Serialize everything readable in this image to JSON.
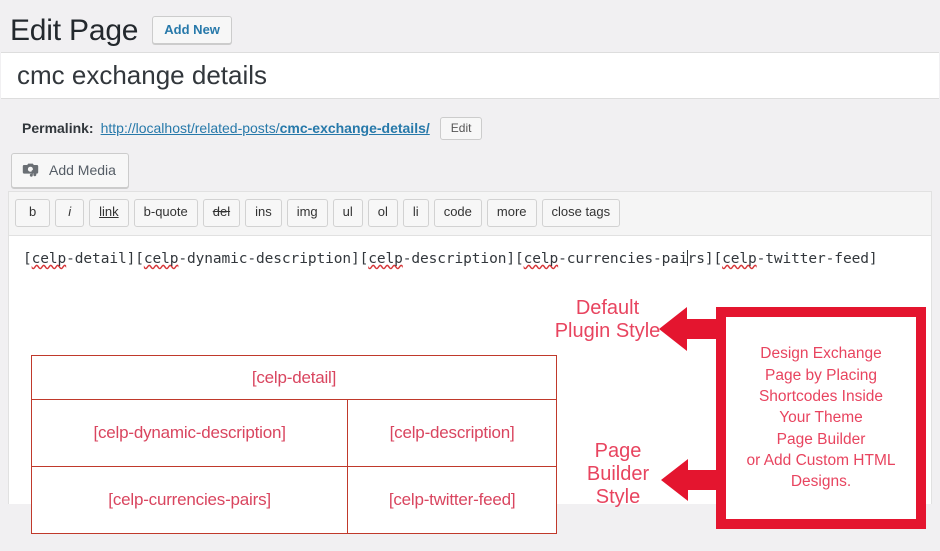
{
  "header": {
    "title": "Edit Page",
    "add_new_label": "Add New"
  },
  "title_field": {
    "value": "cmc exchange details"
  },
  "permalink": {
    "label": "Permalink:",
    "base": "http://localhost/related-posts/",
    "slug": "cmc-exchange-details/",
    "edit_label": "Edit"
  },
  "media": {
    "add_media_label": "Add Media",
    "icon": "camera-music-icon"
  },
  "quicktags": [
    {
      "label": "b",
      "style": "style-bold"
    },
    {
      "label": "i",
      "style": "style-italic"
    },
    {
      "label": "link",
      "style": "style-underline"
    },
    {
      "label": "b-quote",
      "style": ""
    },
    {
      "label": "del",
      "style": "style-strike"
    },
    {
      "label": "ins",
      "style": ""
    },
    {
      "label": "img",
      "style": ""
    },
    {
      "label": "ul",
      "style": ""
    },
    {
      "label": "ol",
      "style": ""
    },
    {
      "label": "li",
      "style": ""
    },
    {
      "label": "code",
      "style": ""
    },
    {
      "label": "more",
      "style": ""
    },
    {
      "label": "close tags",
      "style": ""
    }
  ],
  "editor": {
    "content": "[celp-detail][celp-dynamic-description][celp-description][celp-currencies-pairs][celp-twitter-feed]",
    "segments": {
      "s1_open": "[",
      "s1_misspell": "celp",
      "s1_rest": "-detail][",
      "s2_misspell": "celp",
      "s2_rest": "-dynamic-description][",
      "s3_misspell": "celp",
      "s3_rest": "-description][",
      "s4_misspell": "celp",
      "s4_rest_a": "-currencies-pai",
      "s4_rest_b": "rs][",
      "s5_misspell": "celp",
      "s5_rest": "-twitter-feed]"
    }
  },
  "layout_table": {
    "detail": "[celp-detail]",
    "dynamic_description": "[celp-dynamic-description]",
    "description": "[celp-description]",
    "currencies_pairs": "[celp-currencies-pairs]",
    "twitter_feed": "[celp-twitter-feed]"
  },
  "annotations": {
    "default_style_line1": "Default",
    "default_style_line2": "Plugin Style",
    "builder_style_line1": "Page",
    "builder_style_line2": "Builder",
    "builder_style_line3": "Style"
  },
  "callout": {
    "line1": "Design Exchange",
    "line2": "Page by Placing",
    "line3": "Shortcodes Inside",
    "line4": "Your Theme",
    "line5": "Page Builder",
    "line6": "or Add Custom HTML",
    "line7": "Designs."
  },
  "colors": {
    "accent_red": "#e4152f",
    "text_red": "#e8445f",
    "table_border": "#c0392b",
    "wp_blue": "#2779aa",
    "admin_gray": "#f1f0f2"
  }
}
